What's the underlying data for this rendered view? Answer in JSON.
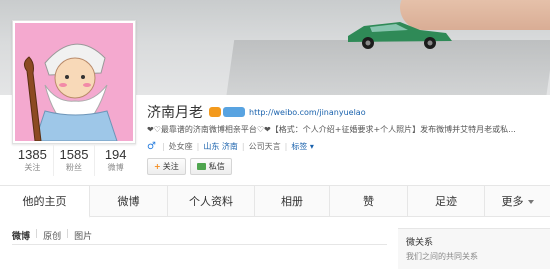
{
  "profile": {
    "name": "济南月老",
    "url": "http://weibo.com/jinanyuelao",
    "intro": "❤♡最靠谱的济南微博相亲平台♡❤【格式：个人介绍+征婚要求+个人照片】发布微博并艾特月老或私...",
    "gender_icon": "♂",
    "category": "处女座",
    "location": "山东 济南",
    "company": "公司天言",
    "tag_label": "标签 ▾"
  },
  "stats": [
    {
      "num": "1385",
      "label": "关注"
    },
    {
      "num": "1585",
      "label": "粉丝"
    },
    {
      "num": "194",
      "label": "微博"
    }
  ],
  "buttons": {
    "follow": "关注",
    "message": "私信"
  },
  "tabs": {
    "home": "他的主页",
    "weibo": "微博",
    "profile": "个人资料",
    "album": "相册",
    "like": "赞",
    "track": "足迹",
    "more": "更多"
  },
  "subnav": {
    "weibo": "微博",
    "original": "原创",
    "pictures": "图片"
  },
  "side": {
    "title": "微关系",
    "subtitle": "我们之间的共同关系"
  },
  "colors": {
    "link": "#1a62ad",
    "follow_plus": "#f58c1e",
    "avatar_bg": "#f4a9cf"
  }
}
